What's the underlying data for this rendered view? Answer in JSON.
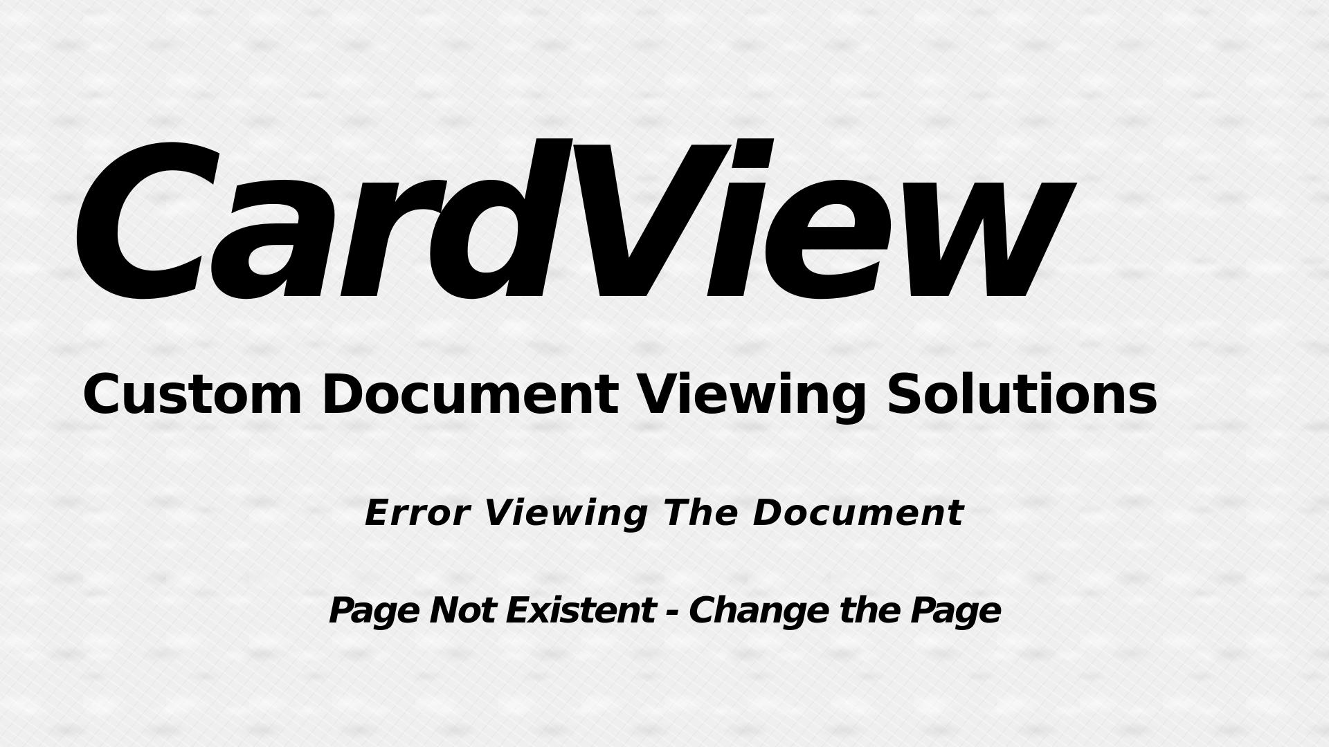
{
  "brand": {
    "logo_text": "CardView",
    "tagline": "Custom Document Viewing Solutions"
  },
  "error": {
    "title": "Error Viewing The Document",
    "message": "Page Not Existent - Change the Page"
  },
  "colors": {
    "background": "#efefef",
    "text": "#000000"
  }
}
